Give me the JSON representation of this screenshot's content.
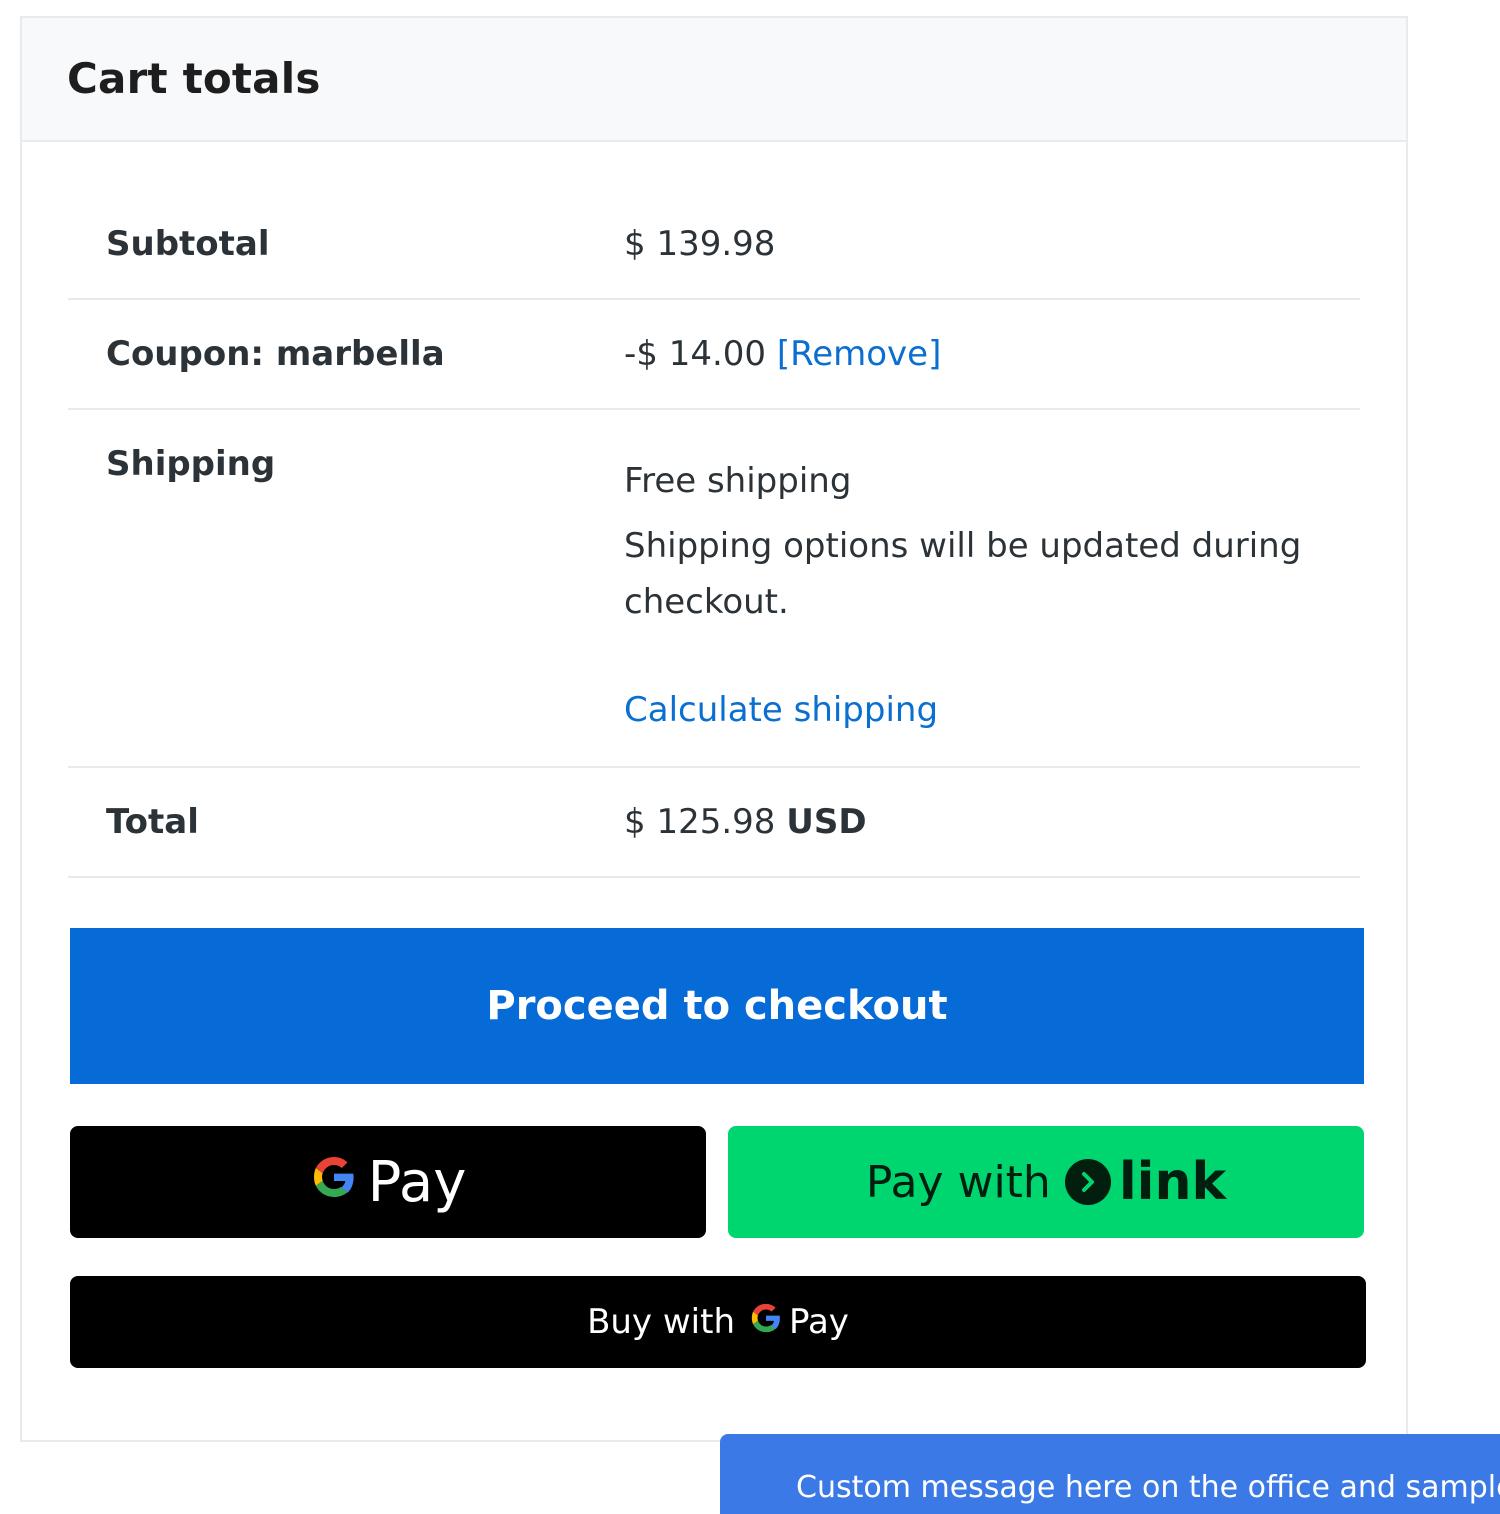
{
  "header": {
    "title": "Cart totals"
  },
  "totals": {
    "subtotal": {
      "label": "Subtotal",
      "value": "$ 139.98"
    },
    "coupon": {
      "label": "Coupon: marbella",
      "value": "-$ 14.00",
      "remove_link": "[Remove]"
    },
    "shipping": {
      "label": "Shipping",
      "method": "Free shipping",
      "note": "Shipping options will be updated during checkout.",
      "calculate_link": "Calculate shipping"
    },
    "total": {
      "label": "Total",
      "value": "$ 125.98",
      "currency": "USD"
    }
  },
  "actions": {
    "checkout_label": "Proceed to checkout",
    "gpay_label": "Pay",
    "link_prefix": "Pay with",
    "link_brand": "link",
    "buy_with_gpay_prefix": "Buy with",
    "buy_with_gpay_brand": "Pay"
  },
  "toast": {
    "text": "Custom message here on the office and sample"
  },
  "colors": {
    "accent": "#066bd6",
    "link": "#0a6fd1",
    "link_button_bg": "#00d66f",
    "gpay_bg": "#000000",
    "toast_bg": "#3a79e6"
  }
}
